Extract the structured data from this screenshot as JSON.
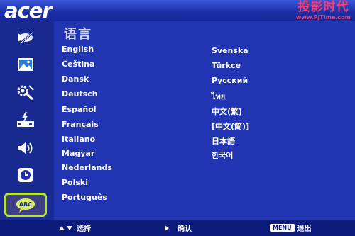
{
  "brand": {
    "logo": "acer"
  },
  "watermark": {
    "title": "投影时代",
    "url": "www.PjTime.com"
  },
  "page": {
    "title": "语言"
  },
  "sidebar": {
    "items": [
      {
        "icon": "display-icon"
      },
      {
        "icon": "image-icon"
      },
      {
        "icon": "settings-icon"
      },
      {
        "icon": "management-icon"
      },
      {
        "icon": "audio-icon"
      },
      {
        "icon": "timer-icon"
      },
      {
        "icon": "language-icon",
        "badge": "ABC"
      }
    ]
  },
  "languages_left": [
    "English",
    "Čeština",
    "Dansk",
    "Deutsch",
    "Español",
    "Français",
    "Italiano",
    "Magyar",
    "Nederlands",
    "Polski",
    "Português"
  ],
  "languages_right": [
    "Svenska",
    "Türkçe",
    "Русский",
    "ไทย",
    "中文(繁)",
    "[中文(简)]",
    "日本語",
    "한국어"
  ],
  "footer": {
    "select_label": "选择",
    "confirm_label": "确认",
    "menu_key": "MENU",
    "exit_label": "退出"
  },
  "colors": {
    "accent": "#b7e332",
    "background": "#2135b3"
  }
}
